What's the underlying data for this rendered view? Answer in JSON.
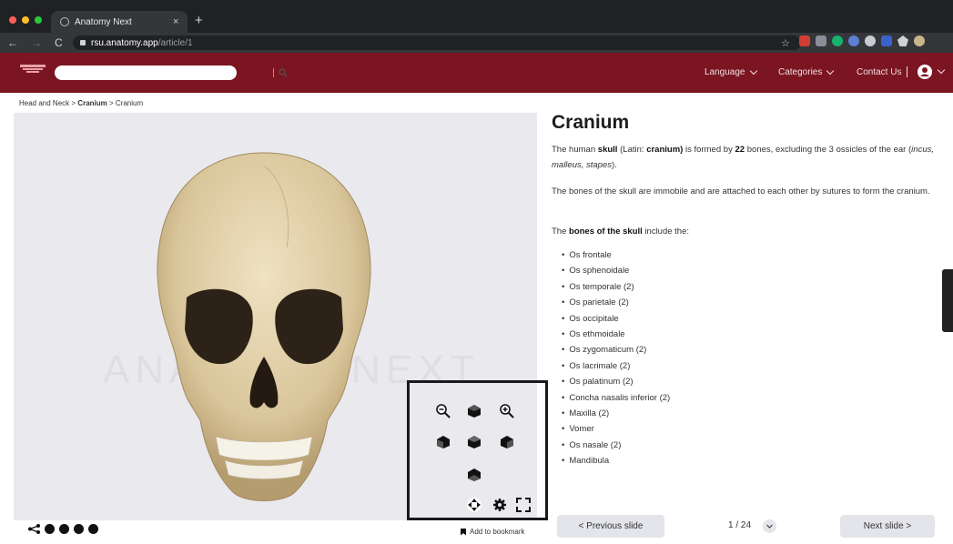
{
  "browser": {
    "tab_title": "Anatomy Next",
    "tab_close": "×",
    "new_tab": "+",
    "url_host": "rsu.anatomy.app",
    "url_path": "/article/1",
    "back": "←",
    "forward": "→",
    "reload": "C",
    "star": "☆"
  },
  "header": {
    "search_placeholder": "",
    "menu": [
      {
        "label": "Language"
      },
      {
        "label": "Categories"
      },
      {
        "label": "Contact Us"
      }
    ],
    "accent_color": "#7a1521"
  },
  "breadcrumb": {
    "first": "Head and Neck",
    "sep": ">",
    "second": "Cranium",
    "third": "Cranium"
  },
  "viewer": {
    "watermark": "ANATOMY NEXT",
    "controls": [
      "zoom-out-icon",
      "rotate-up-icon",
      "zoom-in-icon",
      "rotate-left-icon",
      "center-cube-icon",
      "rotate-right-icon",
      "rotate-down-icon",
      "pan-icon",
      "settings-icon",
      "fullscreen-icon"
    ]
  },
  "share": {
    "bookmark_label": "Add to bookmark"
  },
  "article": {
    "title": "Cranium",
    "p1_a": "The human ",
    "p1_b": "skull",
    "p1_c": " (Latin: ",
    "p1_d": "cranium)",
    "p1_e": " is formed by ",
    "p1_f": "22",
    "p1_g": " bones, excluding the 3 ossicles of the ear (",
    "p1_h": "incus, malleus, stapes",
    "p1_i": ").",
    "p2": "The bones of the skull are immobile and are attached to each other by sutures to form the cranium.",
    "p3_a": "The ",
    "p3_b": "bones of the skull",
    "p3_c": " include the:",
    "bones": [
      "Os frontale",
      "Os sphenoidale",
      "Os temporale (2)",
      "Os parietale (2)",
      "Os occipitale",
      "Os ethmoidale",
      "Os zygomaticum (2)",
      "Os lacrimale (2)",
      "Os palatinum (2)",
      "Concha nasalis inferior (2)",
      "Maxilla (2)",
      "Vomer",
      "Os nasale (2)",
      "Mandibula"
    ]
  },
  "pager": {
    "prev": "<  Previous slide",
    "next": "Next slide  >",
    "indicator": "1 / 24"
  }
}
